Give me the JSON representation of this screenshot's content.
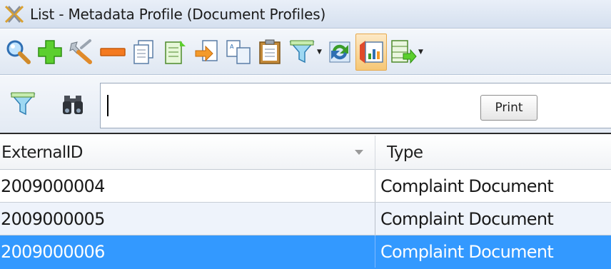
{
  "window": {
    "title": "List - Metadata Profile (Document Profiles)",
    "app_icon": "xwing-logo-icon"
  },
  "toolbar": {
    "buttons": [
      {
        "icon": "search-icon"
      },
      {
        "icon": "add-icon"
      },
      {
        "icon": "wrench-icon"
      },
      {
        "icon": "remove-icon"
      },
      {
        "icon": "copy-icon"
      },
      {
        "icon": "edit-document-icon"
      },
      {
        "icon": "export-icon"
      },
      {
        "icon": "duplicate-icon"
      },
      {
        "icon": "clipboard-icon"
      },
      {
        "icon": "filter-dropdown-icon"
      },
      {
        "icon": "refresh-icon"
      },
      {
        "icon": "report-icon",
        "pressed": true
      },
      {
        "icon": "columns-dropdown-icon"
      }
    ]
  },
  "filterbar": {
    "search_value": "",
    "print_label": "Print"
  },
  "grid": {
    "columns": [
      "ExternalID",
      "Type"
    ],
    "rows": [
      {
        "external_id": "2009000004",
        "type": "Complaint Document",
        "selected": false
      },
      {
        "external_id": "2009000005",
        "type": "Complaint Document",
        "selected": false
      },
      {
        "external_id": "2009000006",
        "type": "Complaint Document",
        "selected": true
      }
    ]
  },
  "colors": {
    "selection": "#3399ff",
    "alt_row": "#eef3fb",
    "chrome": "#dfe7f2"
  }
}
